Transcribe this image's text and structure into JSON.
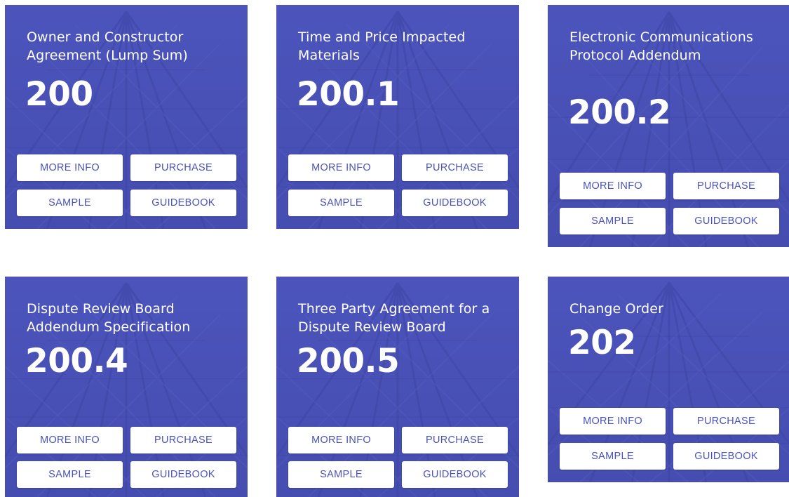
{
  "colors": {
    "card_bg": "#4a52b8",
    "button_bg": "#ffffff",
    "button_text": "#4a52b8",
    "title_text": "#ffffff"
  },
  "cards": [
    {
      "title": "Owner and Constructor Agreement (Lump Sum)",
      "number": "200",
      "buttons": {
        "more_info": "MORE INFO",
        "purchase": "PURCHASE",
        "sample": "SAMPLE",
        "guidebook": "GUIDEBOOK"
      }
    },
    {
      "title": "Time and Price Impacted Materials",
      "number": "200.1",
      "buttons": {
        "more_info": "MORE INFO",
        "purchase": "PURCHASE",
        "sample": "SAMPLE",
        "guidebook": "GUIDEBOOK"
      }
    },
    {
      "title": "Electronic Communications Protocol Addendum",
      "number": "200.2",
      "buttons": {
        "more_info": "MORE INFO",
        "purchase": "PURCHASE",
        "sample": "SAMPLE",
        "guidebook": "GUIDEBOOK"
      }
    },
    {
      "title": "Dispute Review Board Addendum Specification",
      "number": "200.4",
      "buttons": {
        "more_info": "MORE INFO",
        "purchase": "PURCHASE",
        "sample": "SAMPLE",
        "guidebook": "GUIDEBOOK"
      }
    },
    {
      "title": "Three Party Agreement for a Dispute Review Board",
      "number": "200.5",
      "buttons": {
        "more_info": "MORE INFO",
        "purchase": "PURCHASE",
        "sample": "SAMPLE",
        "guidebook": "GUIDEBOOK"
      }
    },
    {
      "title": "Change Order",
      "number": "202",
      "buttons": {
        "more_info": "MORE INFO",
        "purchase": "PURCHASE",
        "sample": "SAMPLE",
        "guidebook": "GUIDEBOOK"
      }
    }
  ]
}
